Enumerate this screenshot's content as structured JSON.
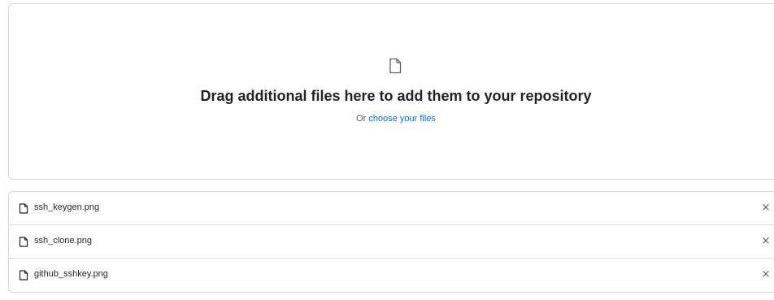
{
  "dropzone": {
    "icon": "file-icon",
    "title": "Drag additional files here to add them to your repository",
    "prefix": "Or ",
    "link_label": "choose your files"
  },
  "files": [
    {
      "name": "ssh_keygen.png",
      "icon": "file-icon",
      "remove_label": "×"
    },
    {
      "name": "ssh_clone.png",
      "icon": "file-icon",
      "remove_label": "×"
    },
    {
      "name": "github_sshkey.png",
      "icon": "file-icon",
      "remove_label": "×"
    }
  ],
  "colors": {
    "link": "#0969da",
    "border": "#d0d7de",
    "text": "#1f2328",
    "muted": "#57606a"
  }
}
